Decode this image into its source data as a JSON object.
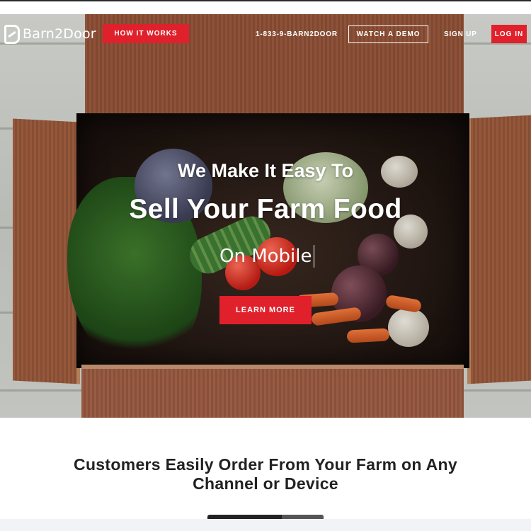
{
  "brand": {
    "name": "Barn2Door"
  },
  "nav": {
    "how_it_works": "HOW IT WORKS",
    "phone": "1-833-9-BARN2DOOR",
    "watch_demo": "WATCH A DEMO",
    "sign_up": "SIGN UP",
    "log_in": "LOG IN"
  },
  "hero": {
    "headline_small": "We Make It Easy To",
    "headline_big": "Sell Your Farm Food",
    "typed_text": "On Mobile",
    "cta": "LEARN MORE"
  },
  "section": {
    "title_line1": "Customers Easily Order From Your Farm on Any",
    "title_line2": "Channel or Device"
  },
  "colors": {
    "accent_red": "#e0202b",
    "text_dark": "#222222",
    "white": "#ffffff"
  },
  "icons": {
    "logo": "barn2door-logo-icon",
    "caret": "text-caret"
  }
}
